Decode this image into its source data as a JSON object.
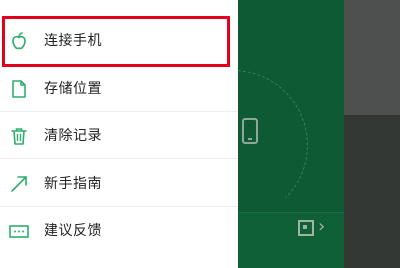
{
  "drawer": {
    "items": [
      {
        "label": "连接手机",
        "icon": "apple-icon"
      },
      {
        "label": "存储位置",
        "icon": "document-icon"
      },
      {
        "label": "清除记录",
        "icon": "trash-icon"
      },
      {
        "label": "新手指南",
        "icon": "arrow-up-right-icon"
      },
      {
        "label": "建议反馈",
        "icon": "feedback-icon"
      }
    ],
    "highlighted_item": "连接手机"
  },
  "background_app": {
    "icons": [
      "phone-icon",
      "qr-code-icon",
      "chevron-right-icon"
    ]
  },
  "colors": {
    "accent_green": "#2fae6e",
    "highlight_red": "#e3001e",
    "background_green": "#0d5a34"
  }
}
